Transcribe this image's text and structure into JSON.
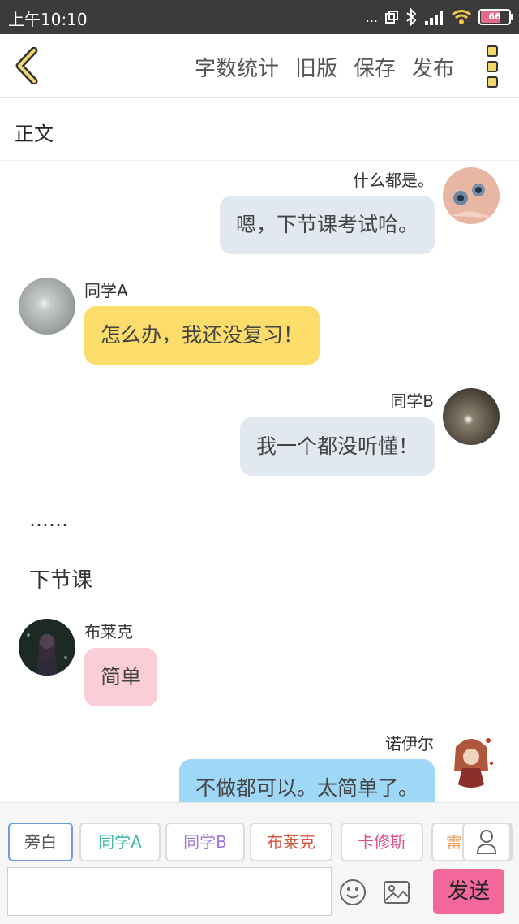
{
  "status_bar": {
    "time": "上午10:10",
    "dots": "...",
    "battery": "66"
  },
  "toolbar": {
    "word_count": "字数统计",
    "old_version": "旧版",
    "save": "保存",
    "publish": "发布"
  },
  "section_label": "正文",
  "messages": [
    {
      "sender": "什么都是。",
      "text": "嗯，下节课考试哈。",
      "side": "right",
      "bubble_color": "#e1e8f0"
    },
    {
      "sender": "同学A",
      "text": "怎么办，我还没复习！",
      "side": "left",
      "bubble_color": "#fcdc6b"
    },
    {
      "sender": "同学B",
      "text": "我一个都没听懂！",
      "side": "right",
      "bubble_color": "#e1e8f0"
    },
    {
      "sender": "布莱克",
      "text": "简单",
      "side": "left",
      "bubble_color": "#fbcdd8"
    },
    {
      "sender": "诺伊尔",
      "text": "不做都可以。太简单了。",
      "side": "right",
      "bubble_color": "#9fd8f7"
    }
  ],
  "narrations": [
    "……",
    "下节课"
  ],
  "characters": [
    {
      "label": "旁白",
      "color": "#555555"
    },
    {
      "label": "同学A",
      "color": "#3fb7a3"
    },
    {
      "label": "同学B",
      "color": "#a178d6"
    },
    {
      "label": "布莱克",
      "color": "#d9543f"
    },
    {
      "label": "卡修斯",
      "color": "#e04b8c"
    },
    {
      "label": "雷",
      "color": "#f0a060"
    }
  ],
  "input": {
    "placeholder": "",
    "value": ""
  },
  "send_label": "发送"
}
